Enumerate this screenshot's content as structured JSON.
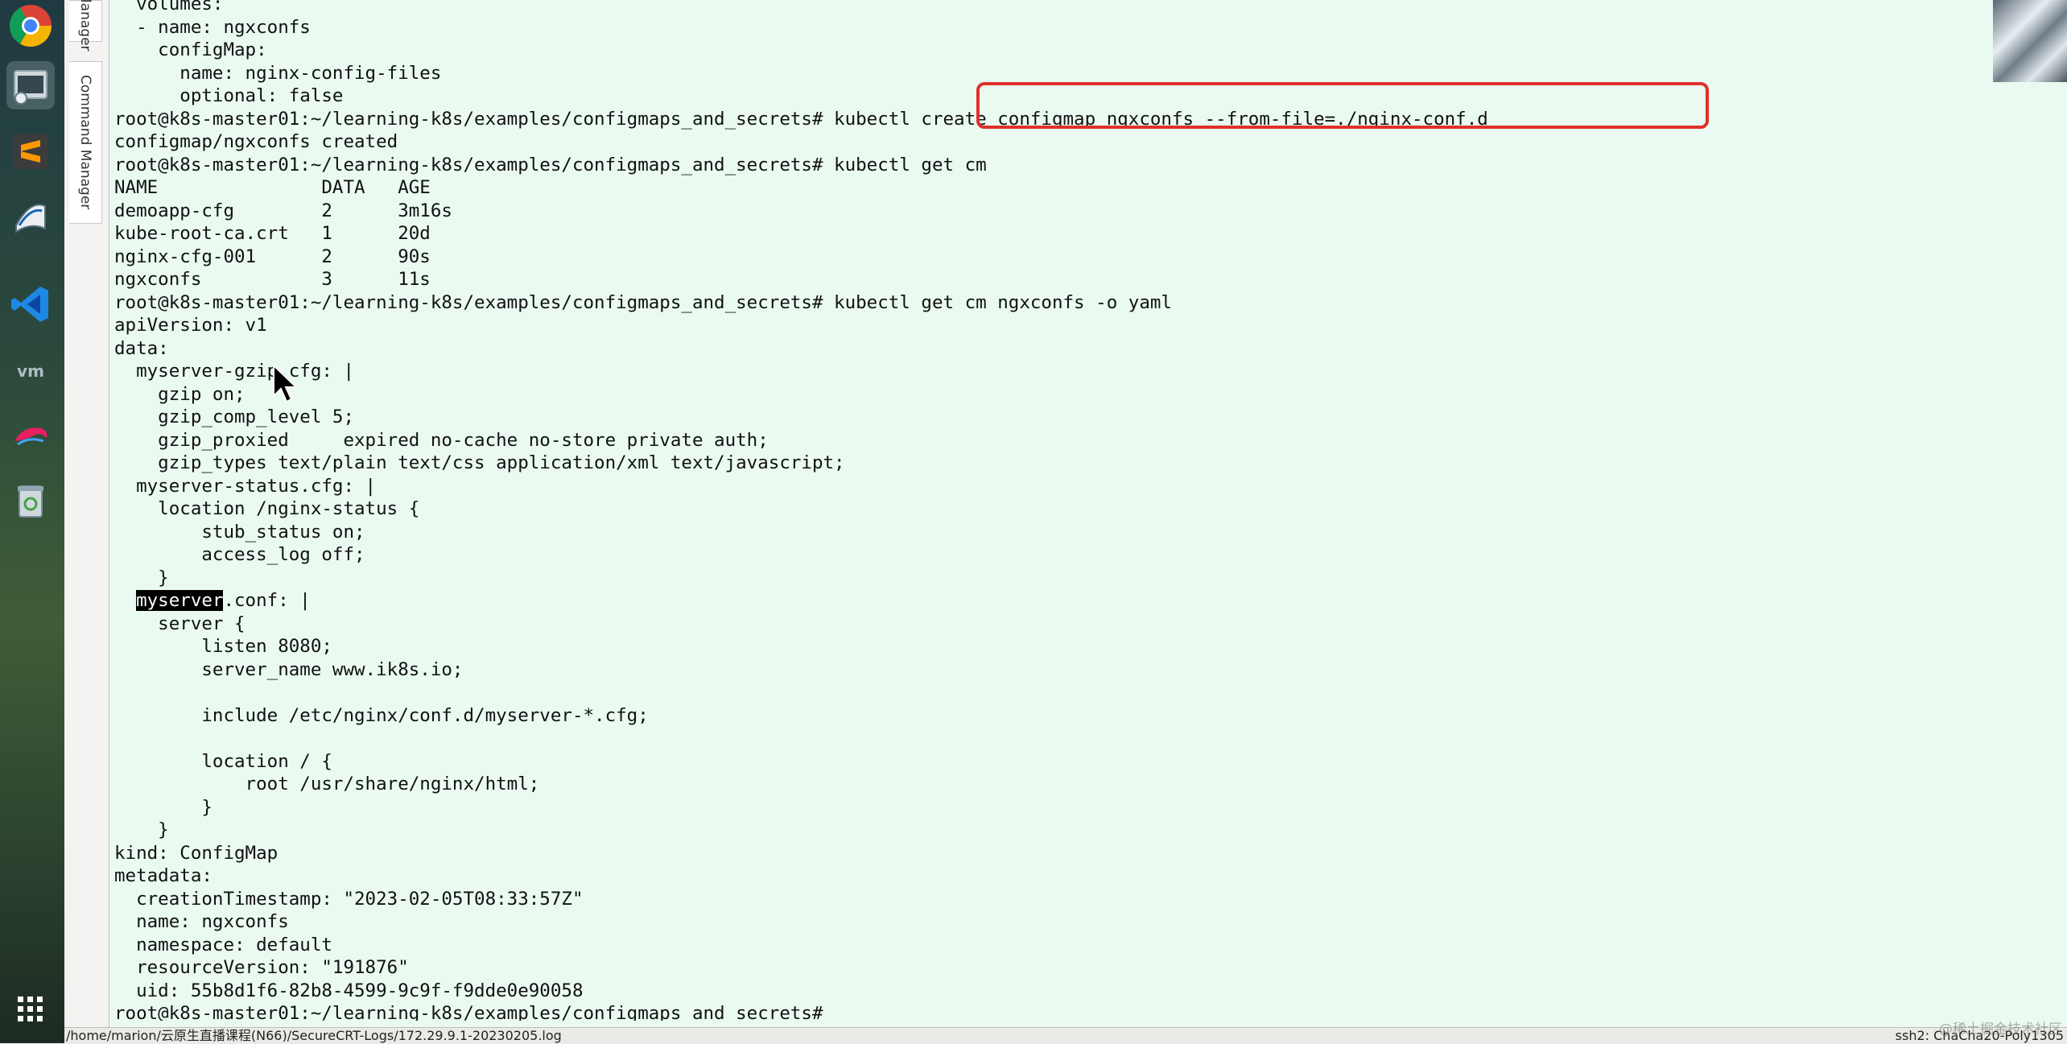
{
  "side_tabs": [
    {
      "label": "Manager"
    },
    {
      "label": "Command Manager"
    }
  ],
  "terminal": {
    "lines": [
      {
        "pre": "  volumes:",
        "sel": "",
        "post": ""
      },
      {
        "pre": "  - name: ngxconfs",
        "sel": "",
        "post": ""
      },
      {
        "pre": "    configMap:",
        "sel": "",
        "post": ""
      },
      {
        "pre": "      name: nginx-config-files",
        "sel": "",
        "post": ""
      },
      {
        "pre": "      optional: false",
        "sel": "",
        "post": ""
      },
      {
        "pre": "root@k8s-master01:~/learning-k8s/examples/configmaps_and_secrets# kubectl create configmap ngxconfs --from-file=./nginx-conf.d",
        "sel": "",
        "post": ""
      },
      {
        "pre": "configmap/ngxconfs created",
        "sel": "",
        "post": ""
      },
      {
        "pre": "root@k8s-master01:~/learning-k8s/examples/configmaps_and_secrets# kubectl get cm",
        "sel": "",
        "post": ""
      },
      {
        "pre": "NAME               DATA   AGE",
        "sel": "",
        "post": ""
      },
      {
        "pre": "demoapp-cfg        2      3m16s",
        "sel": "",
        "post": ""
      },
      {
        "pre": "kube-root-ca.crt   1      20d",
        "sel": "",
        "post": ""
      },
      {
        "pre": "nginx-cfg-001      2      90s",
        "sel": "",
        "post": ""
      },
      {
        "pre": "ngxconfs           3      11s",
        "sel": "",
        "post": ""
      },
      {
        "pre": "root@k8s-master01:~/learning-k8s/examples/configmaps_and_secrets# kubectl get cm ngxconfs -o yaml",
        "sel": "",
        "post": ""
      },
      {
        "pre": "apiVersion: v1",
        "sel": "",
        "post": ""
      },
      {
        "pre": "data:",
        "sel": "",
        "post": ""
      },
      {
        "pre": "  myserver-gzip.cfg: |",
        "sel": "",
        "post": ""
      },
      {
        "pre": "    gzip on;",
        "sel": "",
        "post": ""
      },
      {
        "pre": "    gzip_comp_level 5;",
        "sel": "",
        "post": ""
      },
      {
        "pre": "    gzip_proxied     expired no-cache no-store private auth;",
        "sel": "",
        "post": ""
      },
      {
        "pre": "    gzip_types text/plain text/css application/xml text/javascript;",
        "sel": "",
        "post": ""
      },
      {
        "pre": "  myserver-status.cfg: |",
        "sel": "",
        "post": ""
      },
      {
        "pre": "    location /nginx-status {",
        "sel": "",
        "post": ""
      },
      {
        "pre": "        stub_status on;",
        "sel": "",
        "post": ""
      },
      {
        "pre": "        access_log off;",
        "sel": "",
        "post": ""
      },
      {
        "pre": "    }",
        "sel": "",
        "post": ""
      },
      {
        "pre": "  ",
        "sel": "myserver",
        "post": ".conf: |"
      },
      {
        "pre": "    server {",
        "sel": "",
        "post": ""
      },
      {
        "pre": "        listen 8080;",
        "sel": "",
        "post": ""
      },
      {
        "pre": "        server_name www.ik8s.io;",
        "sel": "",
        "post": ""
      },
      {
        "pre": "",
        "sel": "",
        "post": ""
      },
      {
        "pre": "        include /etc/nginx/conf.d/myserver-*.cfg;",
        "sel": "",
        "post": ""
      },
      {
        "pre": "",
        "sel": "",
        "post": ""
      },
      {
        "pre": "        location / {",
        "sel": "",
        "post": ""
      },
      {
        "pre": "            root /usr/share/nginx/html;",
        "sel": "",
        "post": ""
      },
      {
        "pre": "        }",
        "sel": "",
        "post": ""
      },
      {
        "pre": "    }",
        "sel": "",
        "post": ""
      },
      {
        "pre": "kind: ConfigMap",
        "sel": "",
        "post": ""
      },
      {
        "pre": "metadata:",
        "sel": "",
        "post": ""
      },
      {
        "pre": "  creationTimestamp: \"2023-02-05T08:33:57Z\"",
        "sel": "",
        "post": ""
      },
      {
        "pre": "  name: ngxconfs",
        "sel": "",
        "post": ""
      },
      {
        "pre": "  namespace: default",
        "sel": "",
        "post": ""
      },
      {
        "pre": "  resourceVersion: \"191876\"",
        "sel": "",
        "post": ""
      },
      {
        "pre": "  uid: 55b8d1f6-82b8-4599-9c9f-f9dde0e90058",
        "sel": "",
        "post": ""
      },
      {
        "pre": "root@k8s-master01:~/learning-k8s/examples/configmaps_and_secrets#",
        "sel": "",
        "post": ""
      }
    ]
  },
  "statusbar": {
    "log_path": "/home/marion/云原生直播课程(N66)/SecureCRT-Logs/172.29.9.1-20230205.log",
    "session": "ssh2: ChaCha20-Poly1305"
  },
  "watermark": "@稀土掘金技术社区",
  "colors": {
    "terminal_bg": "#eafaf1",
    "highlight": "#e0302a"
  }
}
